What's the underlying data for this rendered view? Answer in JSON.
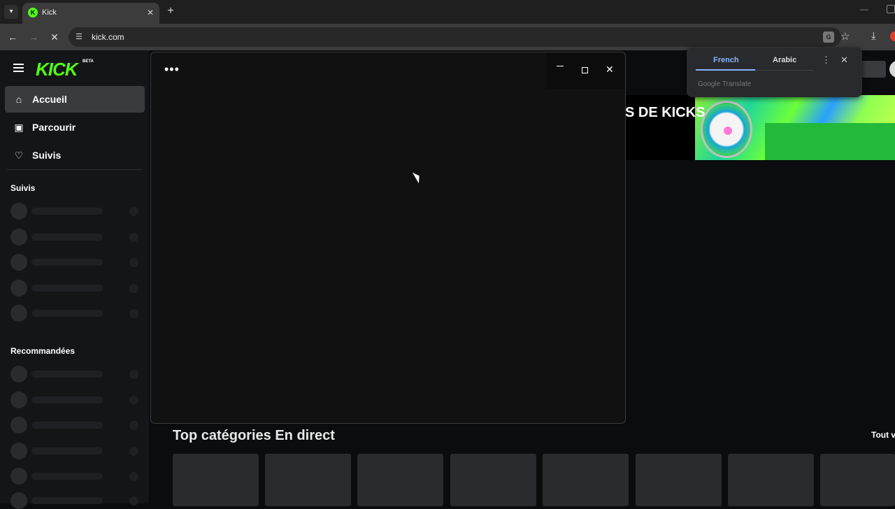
{
  "browser": {
    "tab_title": "Kick",
    "url": "kick.com",
    "tab_close": "✕",
    "new_tab": "+",
    "tab_list": "▾"
  },
  "kick": {
    "logo": "KICK",
    "logo_badge": "BETA",
    "nav": [
      {
        "label": "Accueil",
        "icon": "home-icon",
        "active": true
      },
      {
        "label": "Parcourir",
        "icon": "browse-icon",
        "active": false
      },
      {
        "label": "Suivis",
        "icon": "heart-icon",
        "active": false
      }
    ],
    "followed_heading": "Suivis",
    "recommended_heading": "Recommandées",
    "promo_text": "S DE KICKS",
    "top_categories_heading": "Top catégories En direct",
    "see_all_label": "Tout v"
  },
  "translate_bubble": {
    "source_lang": "French",
    "target_lang": "Arabic",
    "brand": "Google Translate"
  },
  "popup": {
    "menu_label": "•••"
  },
  "colors": {
    "kick_green": "#53fc18",
    "translate_blue": "#8ab4f8"
  }
}
